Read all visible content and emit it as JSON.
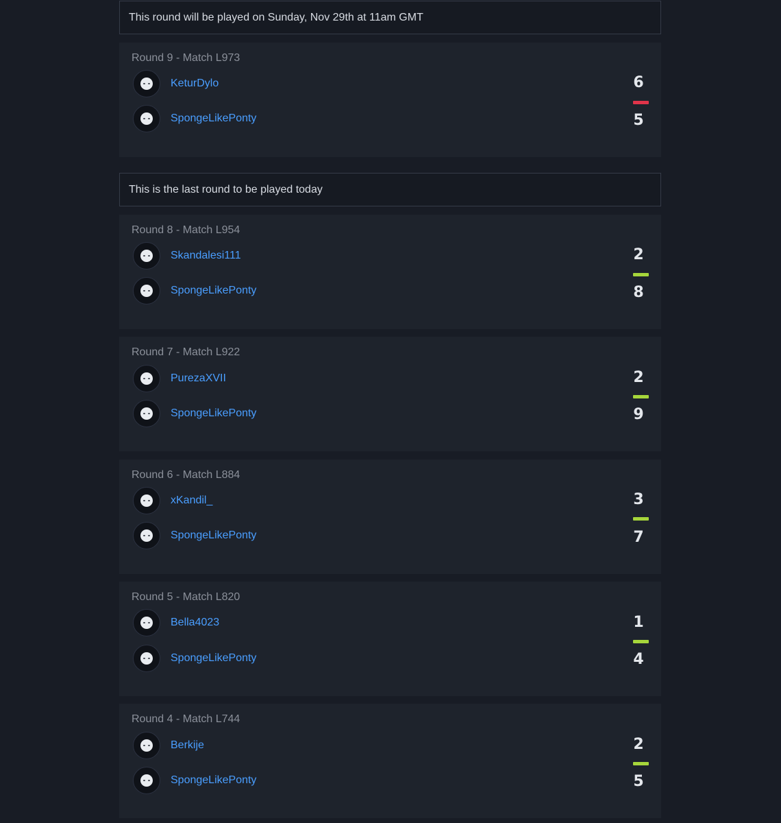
{
  "sections": [
    {
      "notice": "This round will be played on Sunday, Nov 29th at 11am GMT",
      "matches": [
        {
          "title": "Round 9 - Match L973",
          "player1": "KeturDylo",
          "player2": "SpongeLikePonty",
          "score1": "6",
          "score2": "5",
          "result": "loss",
          "result_color": "#e0344a"
        }
      ]
    },
    {
      "notice": "This is the last round to be played today",
      "matches": [
        {
          "title": "Round 8 - Match L954",
          "player1": "Skandalesi111",
          "player2": "SpongeLikePonty",
          "score1": "2",
          "score2": "8",
          "result": "win",
          "result_color": "#a6d63b"
        },
        {
          "title": "Round 7 - Match L922",
          "player1": "PurezaXVII",
          "player2": "SpongeLikePonty",
          "score1": "2",
          "score2": "9",
          "result": "win",
          "result_color": "#a6d63b"
        },
        {
          "title": "Round 6 - Match L884",
          "player1": "xKandil_",
          "player2": "SpongeLikePonty",
          "score1": "3",
          "score2": "7",
          "result": "win",
          "result_color": "#a6d63b"
        },
        {
          "title": "Round 5 - Match L820",
          "player1": "Bella4023",
          "player2": "SpongeLikePonty",
          "score1": "1",
          "score2": "4",
          "result": "win",
          "result_color": "#a6d63b"
        },
        {
          "title": "Round 4 - Match L744",
          "player1": "Berkije",
          "player2": "SpongeLikePonty",
          "score1": "2",
          "score2": "5",
          "result": "win",
          "result_color": "#a6d63b"
        }
      ]
    }
  ],
  "colors": {
    "background": "#181c25",
    "card": "#1e232c",
    "link": "#4a9eff",
    "win": "#a6d63b",
    "loss": "#e0344a"
  }
}
